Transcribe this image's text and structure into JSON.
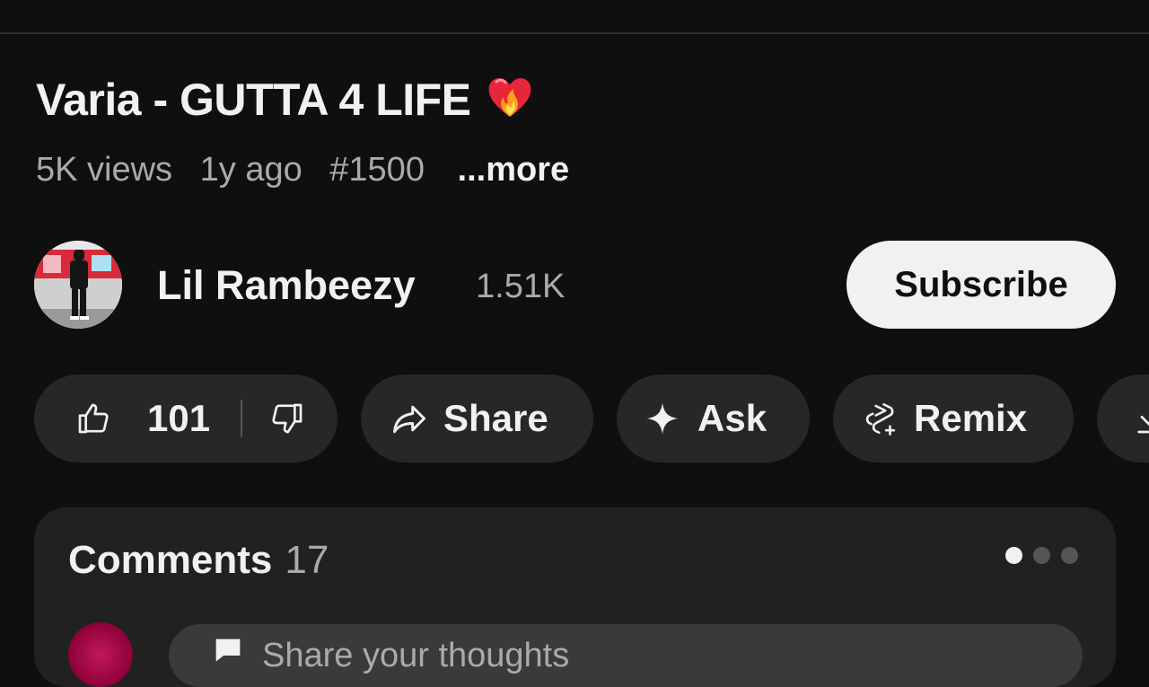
{
  "video": {
    "title": "Varia - GUTTA 4 LIFE",
    "title_emoji": "heart-on-fire",
    "views": "5K views",
    "age": "1y ago",
    "hashtag": "#1500",
    "more_label": "...more"
  },
  "channel": {
    "name": "Lil Rambeezy",
    "subscribers": "1.51K",
    "subscribe_label": "Subscribe"
  },
  "actions": {
    "like_count": "101",
    "share_label": "Share",
    "ask_label": "Ask",
    "remix_label": "Remix"
  },
  "comments": {
    "title": "Comments",
    "count": "17",
    "placeholder": "Share your thoughts"
  },
  "colors": {
    "background": "#0f0f0f",
    "pill": "#272727",
    "card": "#212121",
    "subscribe_bg": "#f1f1f1",
    "secondary_text": "#aaaaaa"
  }
}
